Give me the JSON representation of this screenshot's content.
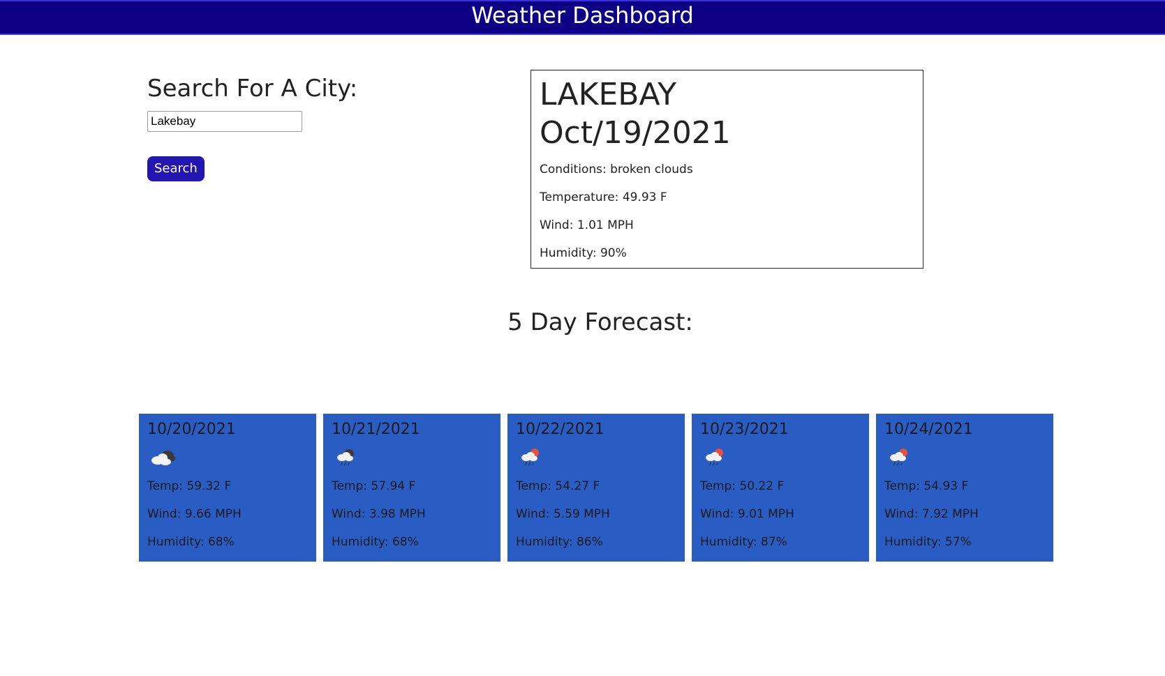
{
  "header": {
    "title": "Weather Dashboard"
  },
  "search": {
    "heading": "Search For A City:",
    "input_value": "Lakebay",
    "button_label": "Search"
  },
  "current": {
    "city": "LAKEBAY",
    "date": "Oct/19/2021",
    "conditions": "Conditions: broken clouds",
    "temperature": "Temperature: 49.93 F",
    "wind": "Wind: 1.01 MPH",
    "humidity": "Humidity: 90%"
  },
  "forecast": {
    "title": "5 Day Forecast:",
    "days": [
      {
        "date": "10/20/2021",
        "icon": "broken-clouds-icon",
        "temp": "Temp: 59.32 F",
        "wind": "Wind: 9.66 MPH",
        "humidity": "Humidity: 68%"
      },
      {
        "date": "10/21/2021",
        "icon": "rain-icon",
        "temp": "Temp: 57.94 F",
        "wind": "Wind: 3.98 MPH",
        "humidity": "Humidity: 68%"
      },
      {
        "date": "10/22/2021",
        "icon": "sun-rain-icon",
        "temp": "Temp: 54.27 F",
        "wind": "Wind: 5.59 MPH",
        "humidity": "Humidity: 86%"
      },
      {
        "date": "10/23/2021",
        "icon": "sun-rain-icon",
        "temp": "Temp: 50.22 F",
        "wind": "Wind: 9.01 MPH",
        "humidity": "Humidity: 87%"
      },
      {
        "date": "10/24/2021",
        "icon": "sun-rain-icon",
        "temp": "Temp: 54.93 F",
        "wind": "Wind: 7.92 MPH",
        "humidity": "Humidity: 57%"
      }
    ]
  },
  "colors": {
    "header_bg": "#0d0085",
    "button_bg": "#2316b0",
    "card_bg": "#295dc4"
  }
}
